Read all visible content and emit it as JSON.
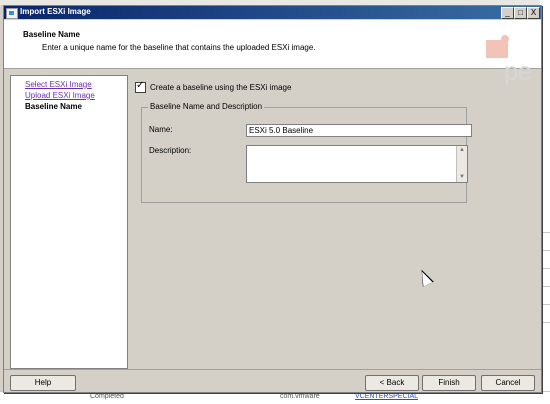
{
  "dialog": {
    "title": "Import ESXi Image",
    "window_buttons": [
      "_",
      "□",
      "X"
    ]
  },
  "header": {
    "title": "Baseline Name",
    "subtitle": "Enter a unique name for the baseline that contains the uploaded ESXi image.",
    "logo_text": "pe"
  },
  "nav": {
    "items": [
      {
        "label": "Select ESXi Image",
        "state": "link"
      },
      {
        "label": "Upload ESXi Image",
        "state": "link"
      },
      {
        "label": "Baseline Name",
        "state": "current"
      }
    ]
  },
  "form": {
    "create_baseline_checked": true,
    "create_baseline_label": "Create a baseline using the ESXi image",
    "group_title": "Baseline Name and Description",
    "name_label": "Name:",
    "name_value": "ESXi 5.0 Baseline",
    "description_label": "Description:",
    "description_value": ""
  },
  "buttons": {
    "help": "Help",
    "back": "< Back",
    "finish": "Finish",
    "cancel": "Cancel"
  },
  "background_taskbar": {
    "items": [
      "Completed",
      "com.vmware",
      "VCENTERSPECIAL"
    ]
  },
  "colors": {
    "titlebar": "#0a246a",
    "dialog_bg": "#d4d0c8",
    "link": "#6b2fb3"
  }
}
